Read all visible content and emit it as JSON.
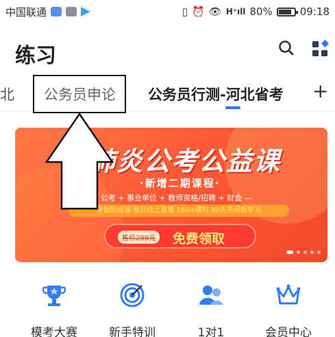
{
  "status_bar": {
    "carrier": "中国联通",
    "network_icon": "hd-icon",
    "battery": "80%",
    "time": "09:18"
  },
  "header": {
    "title": "练习"
  },
  "tabs": {
    "partial_left": "北",
    "items": [
      "公务员申论",
      "公务员行测-河北省考"
    ],
    "active_index": 1,
    "add_label": "+"
  },
  "banner": {
    "title": "抗肺炎公考公益课",
    "subtitle": "·新增二期课程·",
    "categories": "— 公考 + 事业单位 + 教师资格/招聘 + 财会 —",
    "features": "全部阶段课   每日线上直播   160+课时   60天不间断学习",
    "price_tag": "售价299元",
    "cta": "免费领取",
    "dot_count": 5,
    "active_dot": 0
  },
  "quick_nav": [
    {
      "icon": "trophy-icon",
      "label": "模考大赛"
    },
    {
      "icon": "target-icon",
      "label": "新手特训"
    },
    {
      "icon": "people-icon",
      "label": "1对1"
    },
    {
      "icon": "crown-icon",
      "label": "会员中心"
    }
  ],
  "colors": {
    "accent": "#2f7cf6",
    "banner": "#ff5a36",
    "cta": "#ff3b2f"
  }
}
